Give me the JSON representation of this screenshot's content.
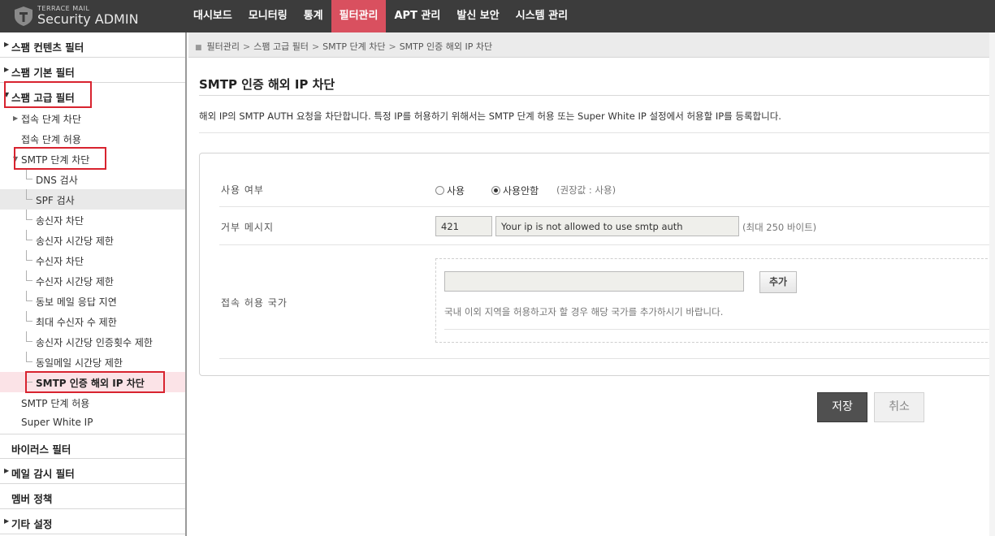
{
  "app": {
    "logo_small": "TERRACE MAIL",
    "logo_big": "Security ADMIN"
  },
  "topnav": {
    "items": [
      {
        "label": "대시보드"
      },
      {
        "label": "모니터링"
      },
      {
        "label": "통계"
      },
      {
        "label": "필터관리",
        "active": true
      },
      {
        "label": "APT 관리"
      },
      {
        "label": "발신 보안"
      },
      {
        "label": "시스템 관리"
      }
    ]
  },
  "sidebar": {
    "groups": [
      {
        "label": "스팸 컨텐츠 필터",
        "arrow": "▶"
      },
      {
        "label": "스팸 기본 필터",
        "arrow": "▶"
      },
      {
        "label": "스팸 고급 필터",
        "arrow": "▼"
      },
      {
        "label": "바이러스 필터",
        "arrow": ""
      },
      {
        "label": "메일 감시 필터",
        "arrow": "▶"
      },
      {
        "label": "멤버 정책",
        "arrow": ""
      },
      {
        "label": "기타 설정",
        "arrow": "▶"
      }
    ],
    "subitems": [
      {
        "label": "접속 단계 차단",
        "arrow": "▶"
      },
      {
        "label": "접속 단계 허용"
      },
      {
        "label": "SMTP 단계 차단",
        "arrow": "▼"
      },
      {
        "label": "DNS 검사"
      },
      {
        "label": "SPF 검사"
      },
      {
        "label": "송신자 차단"
      },
      {
        "label": "송신자 시간당 제한"
      },
      {
        "label": "수신자 차단"
      },
      {
        "label": "수신자 시간당 제한"
      },
      {
        "label": "동보 메일 응답 지연"
      },
      {
        "label": "최대 수신자 수 제한"
      },
      {
        "label": "송신자 시간당 인증횟수 제한"
      },
      {
        "label": "동일메일 시간당 제한"
      },
      {
        "label": "SMTP 인증 해외 IP 차단"
      },
      {
        "label": "SMTP 단계 허용"
      },
      {
        "label": "Super White IP"
      }
    ]
  },
  "breadcrumb": [
    "필터관리",
    "스팸 고급 필터",
    "SMTP 단계 차단",
    "SMTP 인증 해외 IP 차단"
  ],
  "page": {
    "title": "SMTP 인증 해외 IP 차단",
    "description": "해외 IP의 SMTP AUTH 요청을 차단합니다. 특정 IP를 허용하기 위해서는 SMTP 단계 허용 또는 Super White IP 설정에서 허용할 IP를 등록합니다."
  },
  "form": {
    "usage": {
      "label": "사용 여부",
      "option_on": "사용",
      "option_off": "사용안함",
      "selected": "사용안함",
      "hint": "(권장값 : 사용)"
    },
    "reject_message": {
      "label": "거부 메시지",
      "code": "421",
      "message": "Your ip is not allowed to use smtp auth",
      "hint": "(최대 250 바이트)"
    },
    "allowed_countries": {
      "label": "접속 허용 국가",
      "value": "",
      "add_label": "추가",
      "help": "국내 이외 지역을 허용하고자 할 경우 해당 국가를 추가하시기 바랍니다."
    }
  },
  "actions": {
    "save": "저장",
    "cancel": "취소"
  }
}
